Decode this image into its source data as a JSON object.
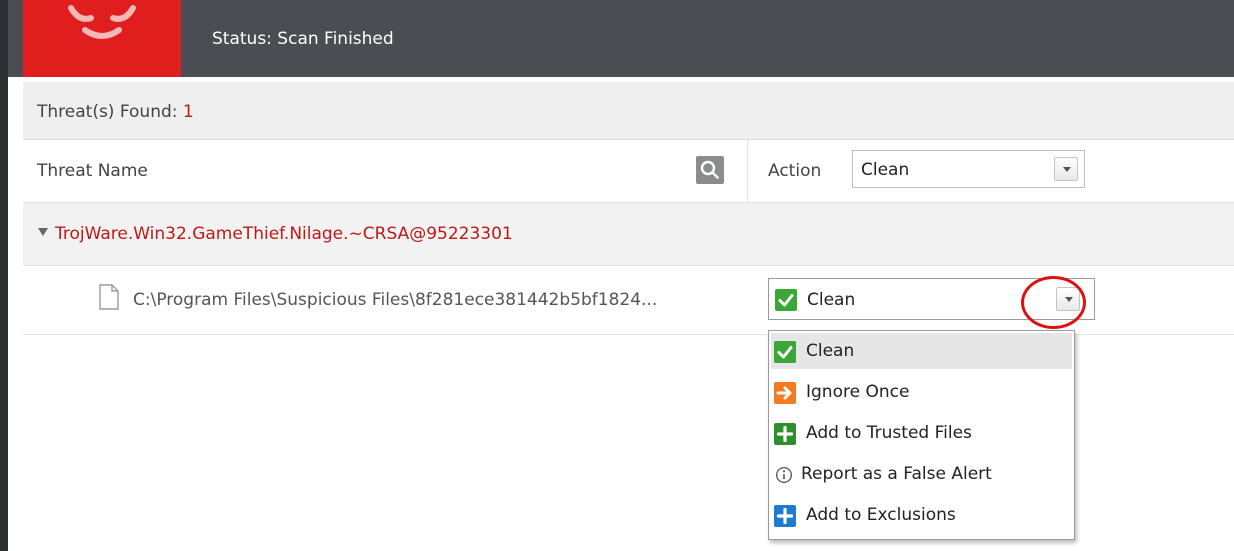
{
  "header": {
    "status_text": "Status: Scan Finished",
    "brand_color": "#e01e1e"
  },
  "summary": {
    "threats_label": "Threat(s) Found: ",
    "threats_count": "1"
  },
  "columns": {
    "threat_name": "Threat Name",
    "action_label": "Action",
    "action_select_value": "Clean"
  },
  "threat_group": {
    "name": "TrojWare.Win32.GameThief.Nilage.~CRSA@95223301"
  },
  "file_row": {
    "path": "C:\\Program Files\\Suspicious Files\\8f281ece381442b5bf1824...",
    "action_value": "Clean"
  },
  "action_menu": {
    "items": [
      {
        "label": "Clean",
        "icon": "green-check-icon"
      },
      {
        "label": "Ignore Once",
        "icon": "orange-arrow-icon"
      },
      {
        "label": "Add to Trusted Files",
        "icon": "green-plus-icon"
      },
      {
        "label": "Report as a False Alert",
        "icon": "info-icon"
      },
      {
        "label": "Add to Exclusions",
        "icon": "blue-plus-icon"
      }
    ]
  }
}
